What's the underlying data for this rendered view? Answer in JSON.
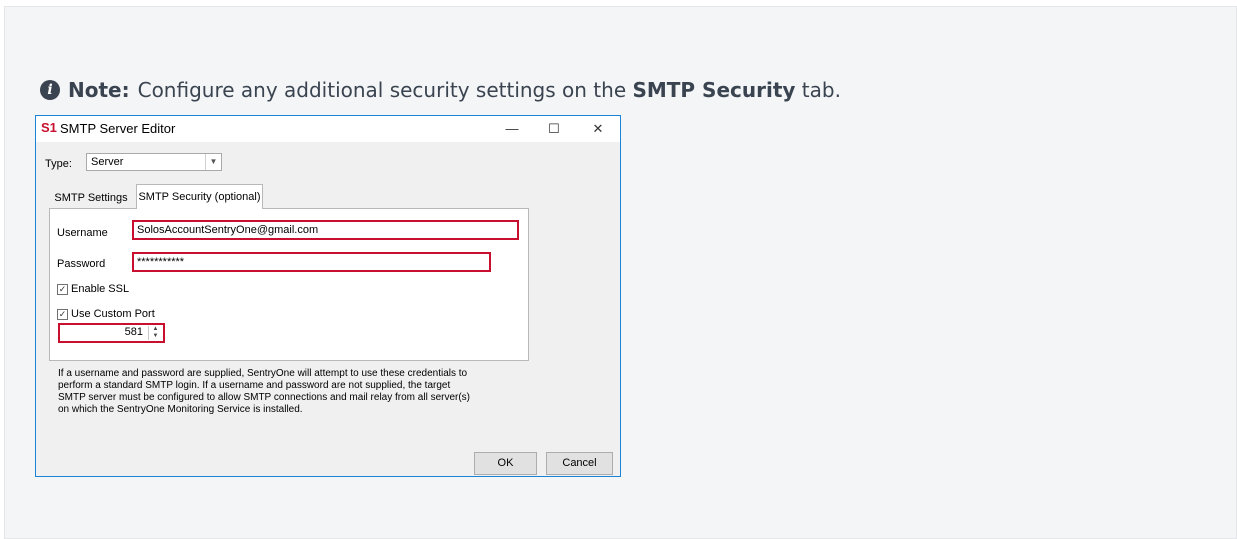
{
  "note": {
    "label": "Note:",
    "text_before": "Configure any additional security settings on the",
    "emphasis": "SMTP Security",
    "text_after": "tab.",
    "icon": "info-circle-icon"
  },
  "dialog": {
    "logo": "S1",
    "title": "SMTP Server Editor",
    "window_buttons": {
      "minimize": "—",
      "maximize": "☐",
      "close": "✕"
    },
    "type_label": "Type:",
    "type_value": "Server",
    "tabs": [
      {
        "label": "SMTP Settings",
        "active": false
      },
      {
        "label": "SMTP Security (optional)",
        "active": true
      }
    ],
    "username_label": "Username",
    "username_value": "SolosAccountSentryOne@gmail.com",
    "password_label": "Password",
    "password_value": "***********",
    "enable_ssl_label": "Enable SSL",
    "enable_ssl_checked": true,
    "custom_port_label": "Use Custom Port",
    "custom_port_checked": true,
    "port_value": "581",
    "info_text": "If a username and password are supplied, SentryOne will attempt to use these credentials to perform a standard SMTP login.  If a username and password are not supplied, the target SMTP server must be configured to allow SMTP connections and mail relay from all server(s) on which the SentryOne Monitoring Service is installed.",
    "ok_label": "OK",
    "cancel_label": "Cancel"
  },
  "colors": {
    "highlight": "#c8102e",
    "window_border": "#1883d7",
    "note_text": "#3a4450"
  }
}
